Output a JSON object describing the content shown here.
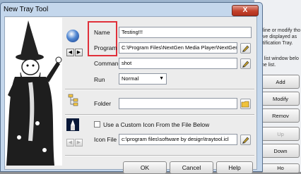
{
  "dialog": {
    "title": "New Tray Tool",
    "close_label": "X"
  },
  "form": {
    "name_label": "Name",
    "name_value": "Testing!!!",
    "program_label": "Program",
    "program_value": "C:\\Program Files\\NextGen Media Player\\NextGen",
    "command_label": "Command",
    "command_value": "shot",
    "run_label": "Run",
    "run_value": "Normal",
    "folder_label": "Folder",
    "folder_value": "",
    "custom_icon_label": "Use a Custom Icon From the File Below",
    "custom_icon_checked": false,
    "icon_file_label": "Icon File",
    "icon_file_value": "c:\\program files\\software by design\\traytool.icl"
  },
  "footer": {
    "ok": "OK",
    "cancel": "Cancel",
    "help": "Help"
  },
  "background_window": {
    "desc_lines": [
      "eline or modify tho",
      "ave displayed as",
      "otification Tray.",
      "",
      "e list window belo",
      "the list."
    ],
    "buttons": [
      "Add",
      "Modify",
      "Remov",
      "Up",
      "Down",
      "Ho"
    ],
    "disabled_button": "Up",
    "bottom_partial": "Ho"
  },
  "colors": {
    "highlight_box": "#e0303a",
    "titlebar": "#c4d7ec"
  }
}
